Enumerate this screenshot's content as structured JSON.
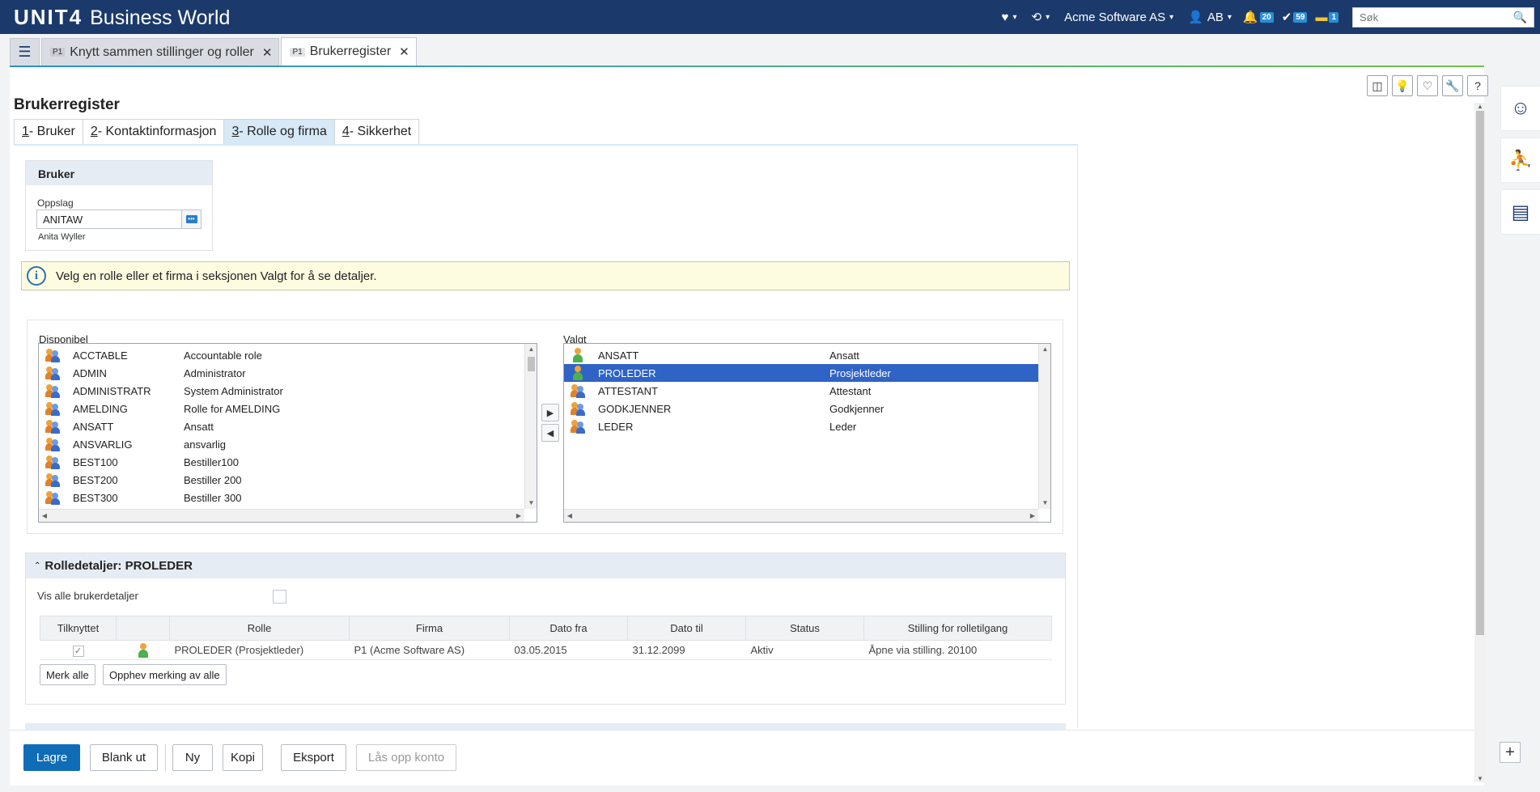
{
  "topbar": {
    "brand": "UNIT4",
    "product": "Business World",
    "company": "Acme Software AS",
    "user_initials": "AB",
    "notifications_count": "20",
    "tasks_count": "59",
    "messages_count": "1",
    "search_placeholder": "Søk"
  },
  "doc_tabs": [
    {
      "prefix": "P1",
      "label": "Knytt sammen stillinger og roller"
    },
    {
      "prefix": "P1",
      "label": "Brukerregister"
    }
  ],
  "page": {
    "title": "Brukerregister",
    "subtabs": [
      {
        "num": "1",
        "label": " - Bruker"
      },
      {
        "num": "2",
        "label": " - Kontaktinformasjon"
      },
      {
        "num": "3",
        "label": " - Rolle og firma"
      },
      {
        "num": "4",
        "label": " - Sikkerhet"
      }
    ]
  },
  "bruker": {
    "heading": "Bruker",
    "lookup_label": "Oppslag",
    "lookup_value": "ANITAW",
    "lookup_desc": "Anita Wyller"
  },
  "info_text": "Velg en rolle eller et firma i seksjonen Valgt for å se detaljer.",
  "available": {
    "label": "Disponibel",
    "items": [
      {
        "code": "ACCTABLE",
        "name": "Accountable role"
      },
      {
        "code": "ADMIN",
        "name": "Administrator"
      },
      {
        "code": "ADMINISTRATR",
        "name": "System Administrator"
      },
      {
        "code": "AMELDING",
        "name": "Rolle for AMELDING"
      },
      {
        "code": "ANSATT",
        "name": "Ansatt"
      },
      {
        "code": "ANSVARLIG",
        "name": "ansvarlig"
      },
      {
        "code": "BEST100",
        "name": "Bestiller100"
      },
      {
        "code": "BEST200",
        "name": "Bestiller 200"
      },
      {
        "code": "BEST300",
        "name": "Bestiller 300"
      }
    ]
  },
  "selected": {
    "label": "Valgt",
    "items": [
      {
        "code": "ANSATT",
        "name": "Ansatt",
        "icon": "single-user-icon"
      },
      {
        "code": "PROLEDER",
        "name": "Prosjektleder",
        "icon": "single-user-icon"
      },
      {
        "code": "ATTESTANT",
        "name": "Attestant",
        "icon": "user-group-icon"
      },
      {
        "code": "GODKJENNER",
        "name": "Godkjenner",
        "icon": "user-group-icon"
      },
      {
        "code": "LEDER",
        "name": "Leder",
        "icon": "user-group-icon"
      }
    ]
  },
  "role_details": {
    "heading": "Rolledetaljer: PROLEDER",
    "show_all_label": "Vis alle brukerdetaljer",
    "columns": [
      "Tilknyttet",
      "",
      "Rolle",
      "Firma",
      "Dato fra",
      "Dato til",
      "Status",
      "Stilling for rolletilgang"
    ],
    "rows": [
      {
        "connected": true,
        "rolle": "PROLEDER (Prosjektleder)",
        "firma": "P1 (Acme Software AS)",
        "dato_fra": "03.05.2015",
        "dato_til": "31.12.2099",
        "status": "Aktiv",
        "stilling": "Åpne via stilling. 20100"
      }
    ],
    "mark_all": "Merk alle",
    "unmark_all": "Opphev merking av alle"
  },
  "footer": {
    "save": "Lagre",
    "blank": "Blank ut",
    "new": "Ny",
    "copy": "Kopi",
    "export": "Eksport",
    "unlock": "Lås opp konto"
  },
  "colors": {
    "topbar": "#1b3a6b",
    "primary_button": "#0f6cb6",
    "selection": "#2f63c5",
    "info_bg": "#fdfce0"
  }
}
